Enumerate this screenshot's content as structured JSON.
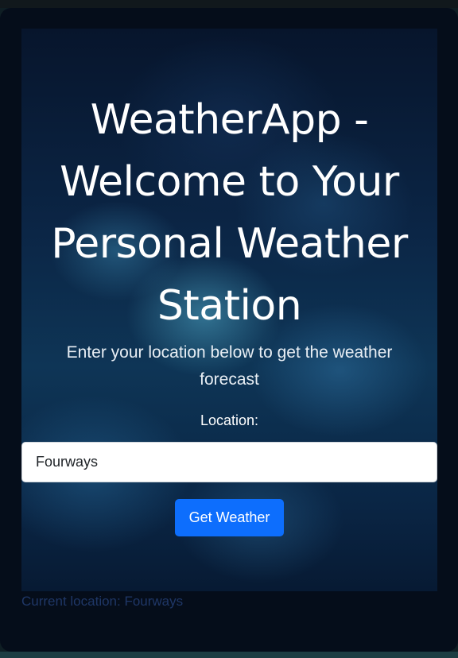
{
  "app": {
    "title": "WeatherApp - Welcome to Your Personal Weather Station",
    "subtitle": "Enter your location below to get the weather forecast"
  },
  "form": {
    "location_label": "Location:",
    "location_value": "Fourways",
    "submit_label": "Get Weather"
  },
  "status": {
    "current_location": "Current location: Fourways"
  },
  "colors": {
    "card_background": "#050d1a",
    "button_primary": "#0d6efd",
    "status_text": "#1f3767",
    "title_text": "#ffffff"
  }
}
